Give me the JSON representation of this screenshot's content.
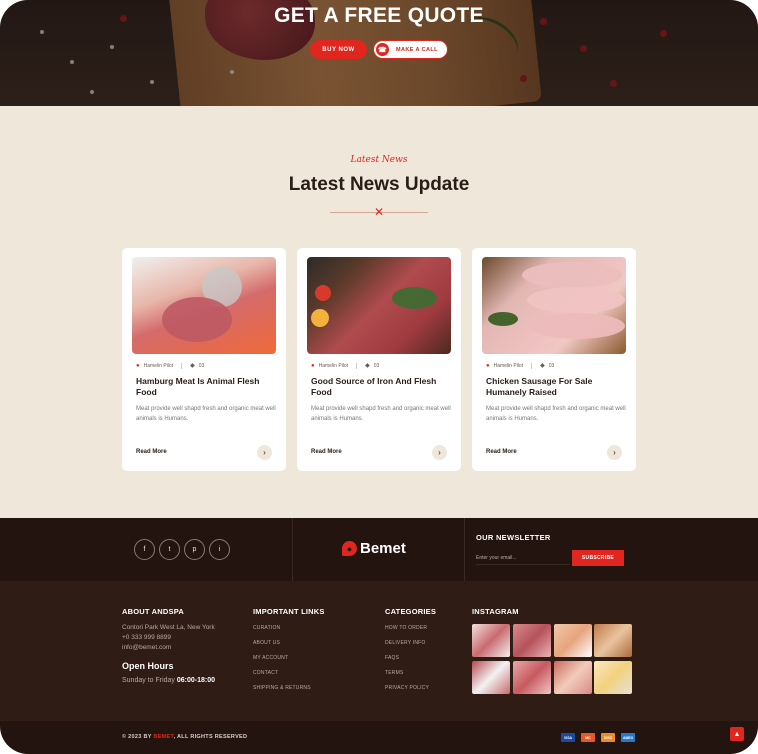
{
  "hero": {
    "title": "GET A FREE QUOTE",
    "buy_label": "BUY NOW",
    "call_label": "MAKE A CALL"
  },
  "news": {
    "eyebrow": "Latest News",
    "title": "Latest News Update",
    "cards": [
      {
        "author": "Hamelin Pilot",
        "comments": "03",
        "title": "Hamburg Meat Is Animal Flesh Food",
        "text": "Meat provide well shapd fresh and organic meat well animals is Humans.",
        "read_more": "Read More"
      },
      {
        "author": "Hamelin Pilot",
        "comments": "03",
        "title": "Good Source of Iron And Flesh Food",
        "text": "Meat provide well shapd fresh and organic meat well animals is Humans.",
        "read_more": "Read More"
      },
      {
        "author": "Hamelin Pilot",
        "comments": "03",
        "title": "Chicken Sausage For Sale Humanely Raised",
        "text": "Meat provide well shapd fresh and organic meat well animals is Humans.",
        "read_more": "Read More"
      }
    ]
  },
  "footer_top": {
    "social": [
      "f",
      "t",
      "p",
      "i"
    ],
    "logo_text": "Bemet",
    "newsletter_title": "OUR NEWSLETTER",
    "newsletter_placeholder": "Enter your email...",
    "subscribe_label": "SUBSCRIBE"
  },
  "footer": {
    "about": {
      "title": "ABOUT ANDSPA",
      "address": "Contori Park West La, New York",
      "phone": "+0 333 999 8899",
      "email": "info@bemet.com",
      "hours_title": "Open Hours",
      "hours_days": "Sunday to Friday",
      "hours_time": "06:00-18:00"
    },
    "links": {
      "title": "IMPORTANT LINKS",
      "items": [
        "CURATION",
        "ABOUT US",
        "MY ACCOUNT",
        "CONTACT",
        "SHIPPING & RETURNS"
      ]
    },
    "categories": {
      "title": "CATEGORIES",
      "items": [
        "HOW TO ORDER",
        "DELIVERY INFO",
        "FAQS",
        "TERMS",
        "PRIVACY POLICY"
      ]
    },
    "instagram": {
      "title": "INSTAGRAM"
    }
  },
  "bottom": {
    "copyright_prefix": "© 2023 BY",
    "copyright_brand": "BEMET",
    "copyright_suffix": ", ALL RIGHTS RESERVED",
    "payments": [
      "VISA",
      "MC",
      "DISC",
      "AMEX"
    ]
  },
  "colors": {
    "accent": "#e0261f",
    "dark": "#24140f",
    "cream": "#efe7d9"
  }
}
